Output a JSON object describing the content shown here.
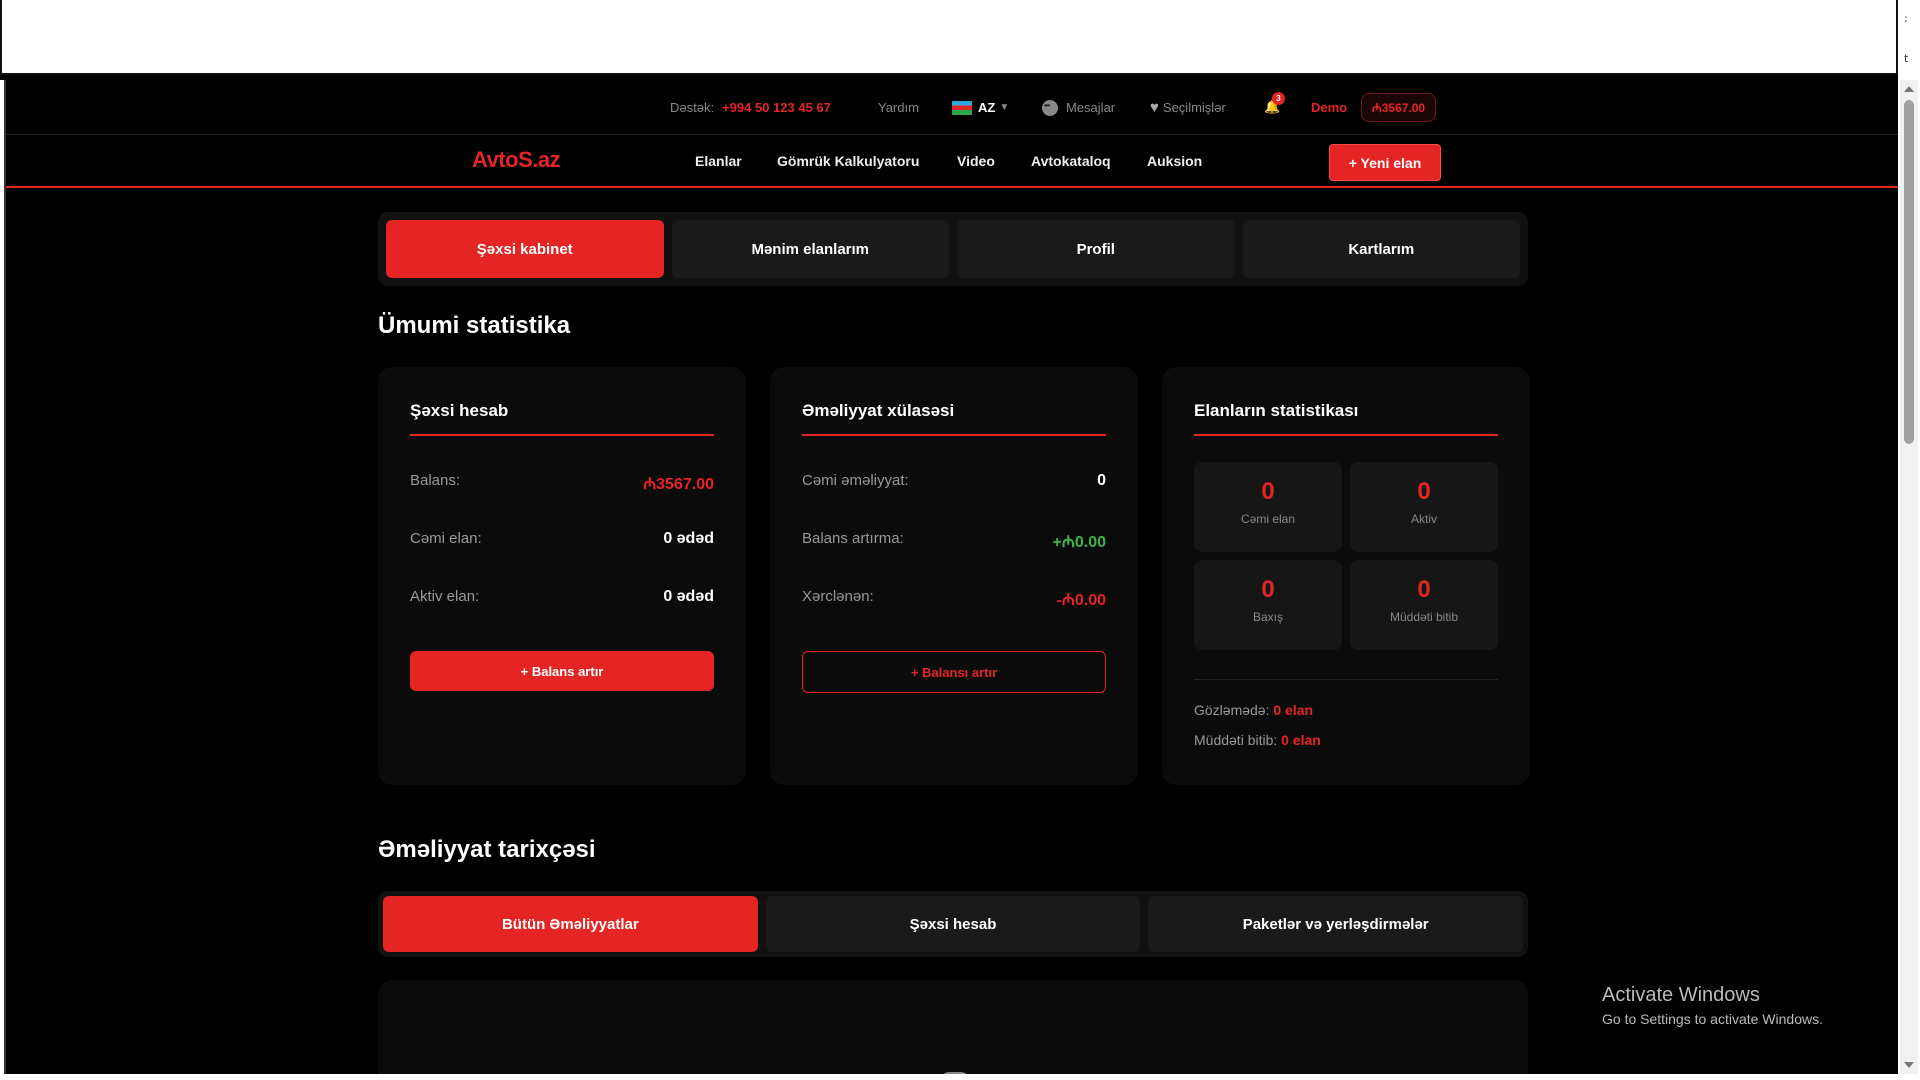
{
  "util": {
    "support_label": "Dəstək:",
    "support_phone": "+994 50 123 45 67",
    "help": "Yardım",
    "lang": "AZ",
    "messages": "Mesajlar",
    "favorites": "Seçilmişlər",
    "notif_count": "3",
    "user": "Demo",
    "balance": "₼3567.00"
  },
  "nav": {
    "logo": "AvtoS.az",
    "links": [
      "Elanlar",
      "Gömrük Kalkulyatoru",
      "Video",
      "Avtokataloq",
      "Auksion"
    ],
    "new_ad": "+ Yeni elan"
  },
  "tabs": [
    "Şəxsi kabinet",
    "Mənim elanlarım",
    "Profil",
    "Kartlarım"
  ],
  "stats_title": "Ümumi statistika",
  "account": {
    "title": "Şəxsi hesab",
    "rows": [
      {
        "label": "Balans:",
        "value": "₼3567.00"
      },
      {
        "label": "Cəmi elan:",
        "value": "0 ədəd"
      },
      {
        "label": "Aktiv elan:",
        "value": "0 ədəd"
      }
    ],
    "button": "+ Balans artır"
  },
  "summary": {
    "title": "Əməliyyat xülasəsi",
    "rows": [
      {
        "label": "Cəmi əməliyyat:",
        "value": "0"
      },
      {
        "label": "Balans artırma:",
        "value": "+₼0.00"
      },
      {
        "label": "Xərclənən:",
        "value": "-₼0.00"
      }
    ],
    "button": "+ Balansı artır"
  },
  "ad_stats": {
    "title": "Elanların statistikası",
    "boxes": [
      {
        "num": "0",
        "label": "Cəmi elan"
      },
      {
        "num": "0",
        "label": "Aktiv"
      },
      {
        "num": "0",
        "label": "Baxış"
      },
      {
        "num": "0",
        "label": "Müddəti bitib"
      }
    ],
    "pending_label": "Gözləmədə:",
    "pending_value": "0 elan",
    "expired_label": "Müddəti bitib:",
    "expired_value": "0 elan"
  },
  "history_title": "Əməliyyat tarixçəsi",
  "history_tabs": [
    "Bütün Əməliyyatlar",
    "Şəxsi hesab",
    "Paketlər və yerləşdirmələr"
  ],
  "windows": {
    "line1": "Activate Windows",
    "line2": "Go to Settings to activate Windows."
  },
  "colors": {
    "accent": "#e52424",
    "positive": "#3bb54a",
    "background": "#000000"
  }
}
